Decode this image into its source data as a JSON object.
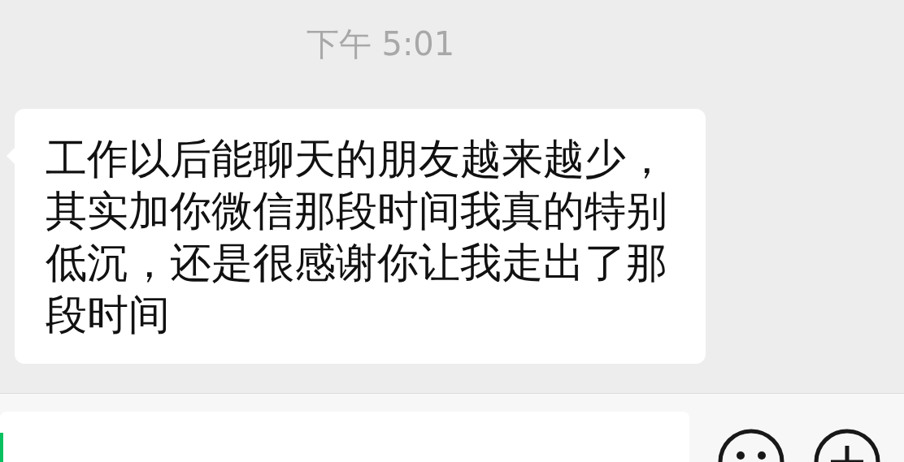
{
  "timestamp": "下午 5:01",
  "messages": [
    {
      "text": "工作以后能聊天的朋友越来越少，其实加你微信那段时间我真的特别低沉，还是很感谢你让我走出了那段时间"
    }
  ]
}
